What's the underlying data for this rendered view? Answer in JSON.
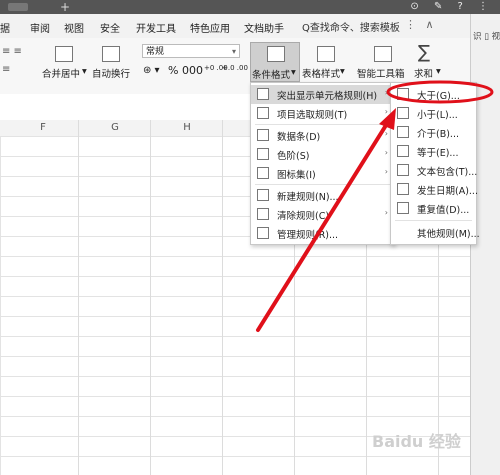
{
  "menubar": {
    "items": [
      "据",
      "审阅",
      "视图",
      "安全",
      "开发工具",
      "特色应用",
      "文档助手"
    ],
    "search": "Q查找命令、搜索模板"
  },
  "ribbon": {
    "merge_label": "合并居中",
    "wrap_label": "自动换行",
    "numfmt_value": "常规",
    "numfmt_symbols": "% 000",
    "decimals_a": "+0 .00",
    "decimals_b": "+.0 .00",
    "condfmt_label": "条件格式",
    "tablestyle_label": "表格样式",
    "smarttools_label": "智能工具箱",
    "sum_label": "求和",
    "sum_symbol": "∑"
  },
  "rightpane": {
    "label": "识 ▯ 视"
  },
  "columns": [
    "F",
    "G",
    "H"
  ],
  "condfmt_menu": [
    {
      "label": "突出显示单元格规则(H)",
      "submenu": true
    },
    {
      "label": "项目选取规则(T)",
      "submenu": true
    },
    {
      "label": "数据条(D)",
      "submenu": true
    },
    {
      "label": "色阶(S)",
      "submenu": true
    },
    {
      "label": "图标集(I)",
      "submenu": true
    },
    {
      "label": "新建规则(N)...",
      "submenu": false
    },
    {
      "label": "清除规则(C)",
      "submenu": true
    },
    {
      "label": "管理规则(R)...",
      "submenu": false
    }
  ],
  "highlight_submenu": [
    {
      "label": "大于(G)..."
    },
    {
      "label": "小于(L)..."
    },
    {
      "label": "介于(B)..."
    },
    {
      "label": "等于(E)..."
    },
    {
      "label": "文本包含(T)..."
    },
    {
      "label": "发生日期(A)..."
    },
    {
      "label": "重复值(D)..."
    },
    {
      "label": "其他规则(M)..."
    }
  ],
  "watermark": "Baidu 经验",
  "colors": {
    "annotation": "#e0101a",
    "menu_highlight": "#d9d9d9"
  }
}
